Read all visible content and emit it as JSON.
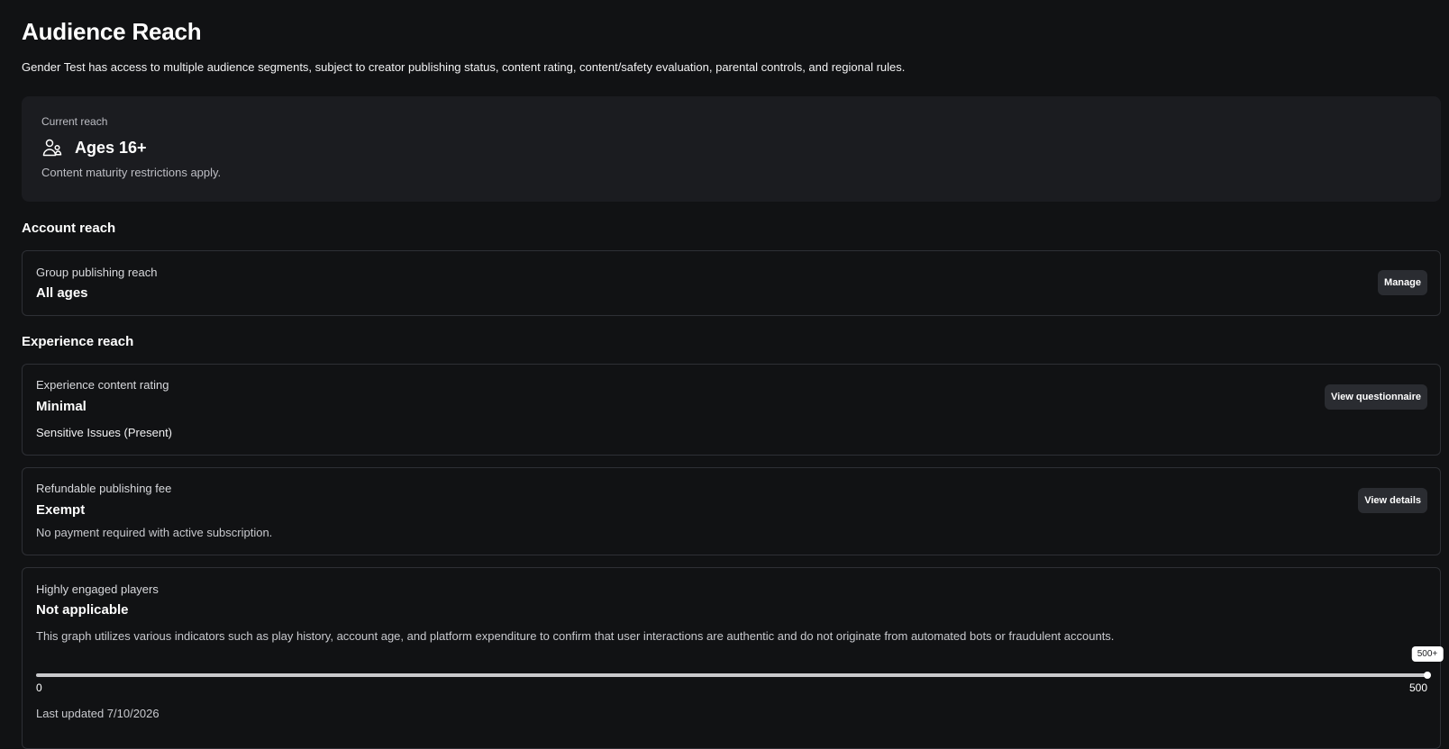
{
  "header": {
    "title": "Audience Reach",
    "subtitle": "Gender Test has access to multiple audience segments, subject to creator publishing status, content rating, content/safety evaluation, parental controls, and regional rules."
  },
  "current_reach": {
    "label": "Current reach",
    "value": "Ages 16+",
    "note": "Content maturity restrictions apply.",
    "icon": "users-icon"
  },
  "account_reach": {
    "heading": "Account reach",
    "group_publishing": {
      "label": "Group publishing reach",
      "value": "All ages",
      "button": "Manage"
    }
  },
  "experience_reach": {
    "heading": "Experience reach",
    "content_rating": {
      "label": "Experience content rating",
      "value": "Minimal",
      "note": "Sensitive Issues (Present)",
      "button": "View questionnaire"
    },
    "publishing_fee": {
      "label": "Refundable publishing fee",
      "value": "Exempt",
      "note": "No payment required with active subscription.",
      "button": "View details"
    },
    "engaged_players": {
      "label": "Highly engaged players",
      "value": "Not applicable",
      "note": "This graph utilizes various indicators such as play history, account age, and platform expenditure to confirm that user interactions are authentic and do not originate from automated bots or fraudulent accounts.",
      "slider": {
        "min_label": "0",
        "max_label": "500",
        "tooltip": "500+",
        "min": 0,
        "max": 500,
        "value": 500
      },
      "last_updated": "Last updated 7/10/2026"
    }
  },
  "colors": {
    "background": "#111214",
    "card_background": "#1b1c20",
    "border": "#2e3035",
    "button_background": "#2a2c31",
    "track": "#c9c9cc"
  }
}
